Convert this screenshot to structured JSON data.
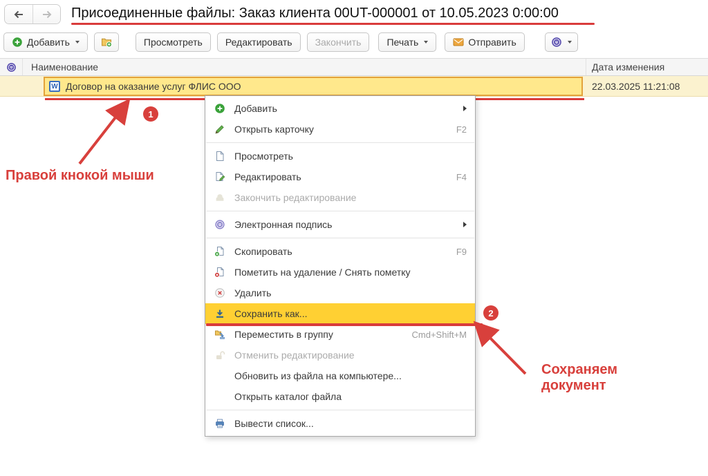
{
  "header": {
    "title": "Присоединенные файлы: Заказ клиента 00UT-000001 от 10.05.2023 0:00:00"
  },
  "toolbar": {
    "add_label": "Добавить",
    "view_label": "Просмотреть",
    "edit_label": "Редактировать",
    "finish_label": "Закончить",
    "print_label": "Печать",
    "send_label": "Отправить"
  },
  "table": {
    "columns": [
      {
        "label": "",
        "icon": "signature-icon"
      },
      {
        "label": "Наименование"
      },
      {
        "label": "Дата изменения"
      }
    ],
    "rows": [
      {
        "icon": "word-file-icon",
        "name": "Договор на оказание услуг ФЛИС ООО",
        "modified": "22.03.2025 11:21:08",
        "selected": true
      }
    ]
  },
  "context_menu": {
    "items": [
      {
        "type": "item",
        "label": "Добавить",
        "icon": "add-icon",
        "submenu": true
      },
      {
        "type": "item",
        "label": "Открыть карточку",
        "icon": "pencil-icon",
        "shortcut": "F2"
      },
      {
        "type": "separator"
      },
      {
        "type": "item",
        "label": "Просмотреть",
        "icon": "document-icon"
      },
      {
        "type": "item",
        "label": "Редактировать",
        "icon": "document-edit-icon",
        "shortcut": "F4"
      },
      {
        "type": "item",
        "label": "Закончить редактирование",
        "icon": "finish-editing-icon",
        "disabled": true
      },
      {
        "type": "separator"
      },
      {
        "type": "item",
        "label": "Электронная подпись",
        "icon": "signature-icon",
        "submenu": true
      },
      {
        "type": "separator"
      },
      {
        "type": "item",
        "label": "Скопировать",
        "icon": "copy-icon",
        "shortcut": "F9"
      },
      {
        "type": "item",
        "label": "Пометить на удаление / Снять пометку",
        "icon": "mark-deletion-icon"
      },
      {
        "type": "item",
        "label": "Удалить",
        "icon": "delete-icon"
      },
      {
        "type": "item",
        "label": "Сохранить как...",
        "icon": "save-as-icon",
        "highlighted": true
      },
      {
        "type": "item",
        "label": "Переместить в группу",
        "icon": "move-to-group-icon",
        "shortcut": "Cmd+Shift+M"
      },
      {
        "type": "item",
        "label": "Отменить редактирование",
        "icon": "unlock-icon",
        "disabled": true
      },
      {
        "type": "item",
        "label": "Обновить из файла на компьютере..."
      },
      {
        "type": "item",
        "label": "Открыть каталог файла"
      },
      {
        "type": "separator"
      },
      {
        "type": "item",
        "label": "Вывести список...",
        "icon": "print-icon"
      }
    ]
  },
  "annotations": {
    "step1_badge": "1",
    "step1_text": "Правой кнокой мыши",
    "step2_badge": "2",
    "step2_text_line1": "Сохраняем",
    "step2_text_line2": "документ",
    "accent_color": "#D93B3B"
  },
  "colors": {
    "row_selected_fill": "#FFE88C",
    "row_selected_border": "#E3A33B",
    "row_fill": "#FBF2CF",
    "menu_highlight_fill": "#FFD033",
    "annotation_red": "#D93B3B"
  }
}
